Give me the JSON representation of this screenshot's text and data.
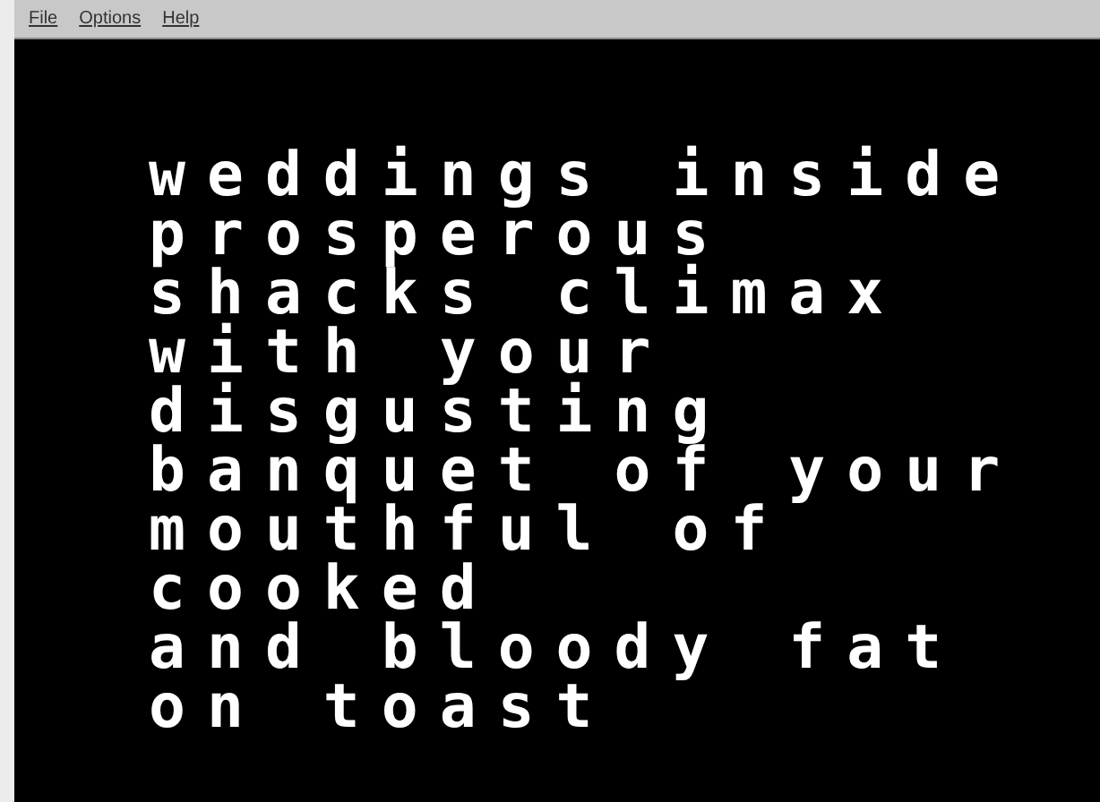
{
  "menu_bar": {
    "items": [
      "File",
      "Options",
      "Help"
    ]
  },
  "screen": {
    "lines": [
      "weddings inside",
      "prosperous",
      "shacks climax",
      "with your",
      "disgusting",
      "banquet of your",
      "mouthful of",
      "cooked",
      "and bloody fat",
      "on toast"
    ]
  }
}
